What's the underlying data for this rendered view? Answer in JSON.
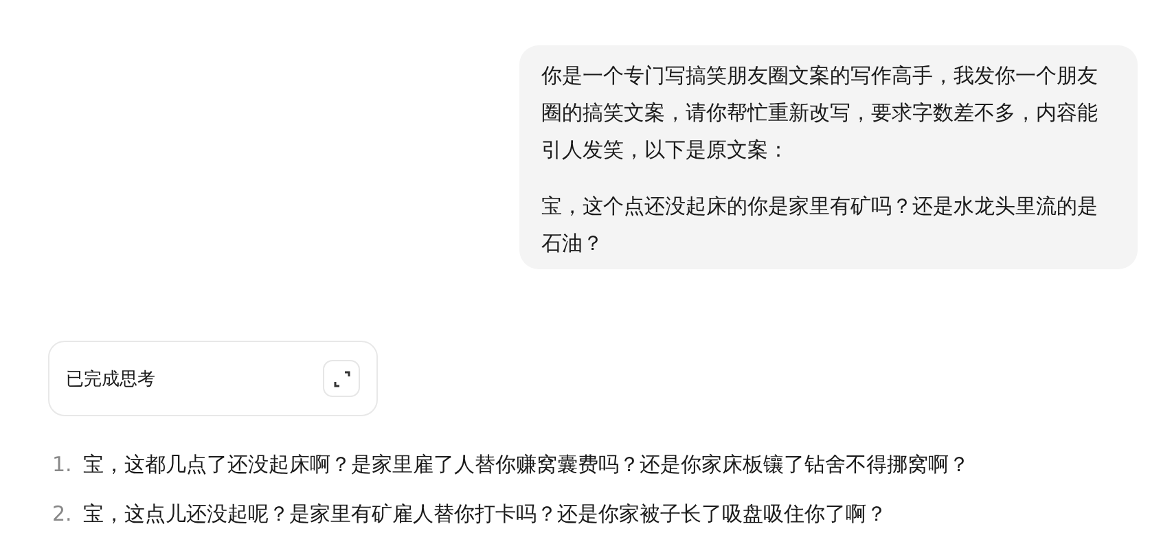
{
  "user_message": {
    "paragraphs": [
      "你是一个专门写搞笑朋友圈文案的写作高手，我发你一个朋友圈的搞笑文案，请你帮忙重新改写，要求字数差不多，内容能引人发笑，以下是原文案：",
      "宝，这个点还没起床的你是家里有矿吗？还是水龙头里流的是石油？"
    ]
  },
  "thinking": {
    "label": "已完成思考",
    "expanded": false
  },
  "answer": {
    "items": [
      {
        "number": "1.",
        "text": "宝，这都几点了还没起床啊？是家里雇了人替你赚窝囊费吗？还是你家床板镶了钻舍不得挪窝啊？"
      },
      {
        "number": "2.",
        "text": "宝，这点儿还没起呢？是家里有矿雇人替你打卡吗？还是你家被子长了吸盘吸住你了啊？"
      }
    ]
  }
}
